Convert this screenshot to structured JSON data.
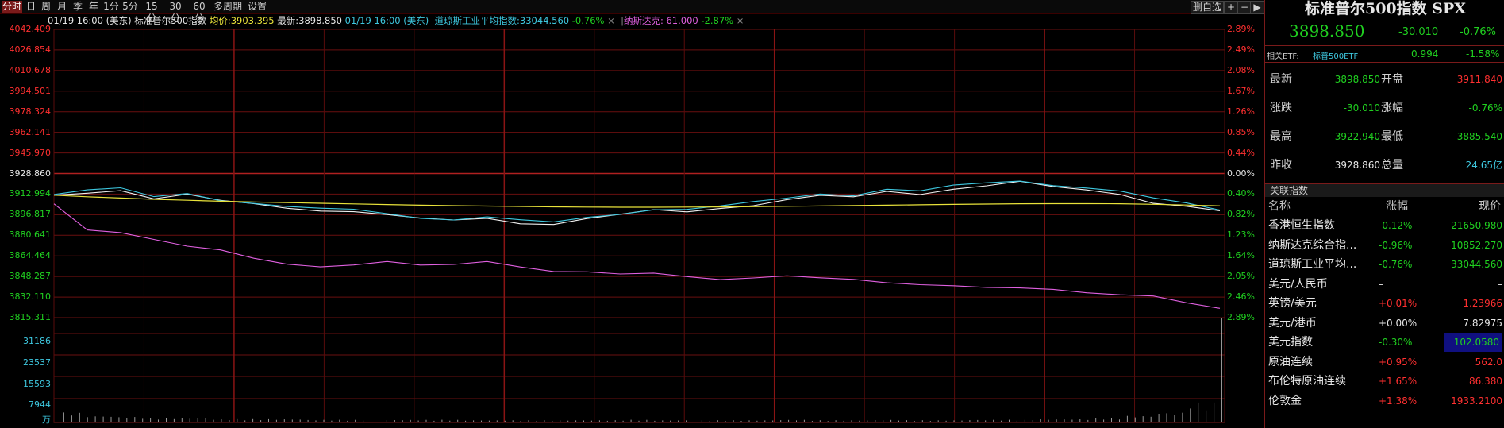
{
  "toolbar": {
    "periods": [
      {
        "label": "分时",
        "active": true
      },
      {
        "label": "日",
        "active": false
      },
      {
        "label": "周",
        "active": false
      },
      {
        "label": "月",
        "active": false
      },
      {
        "label": "季",
        "active": false
      },
      {
        "label": "年",
        "active": false
      },
      {
        "label": "1分",
        "active": false
      },
      {
        "label": "5分",
        "active": false
      },
      {
        "label": "15分",
        "active": false
      },
      {
        "label": "30分",
        "active": false
      },
      {
        "label": "60分",
        "active": false
      },
      {
        "label": "多周期",
        "active": false
      },
      {
        "label": "设置",
        "active": false
      }
    ],
    "remove_watch": "删自选",
    "add_icon": "+",
    "minus_icon": "−",
    "prev_icon": "◀",
    "next_icon": "▶"
  },
  "infoline": {
    "date": "01/19 16:00 (美东)",
    "name": "标准普尔500指数",
    "avg_label": "均价:",
    "avg_value": "3903.395",
    "last_label": "最新:",
    "last_value": "3898.850",
    "cmp_date": "01/19 16:00 (美东)",
    "dji_label": "道琼斯工业平均指数:",
    "dji_value": "33044.560",
    "dji_pct": "-0.76%",
    "close_icon": "×",
    "nas_label": "纳斯达克:",
    "nas_value": "61.000",
    "nas_pct": "-2.87%"
  },
  "chart_data": {
    "type": "line",
    "title": "标准普尔500指数 分时",
    "prev_close": 3928.86,
    "ylim": [
      3815.311,
      4042.409
    ],
    "price_ticks": [
      "4042.409",
      "4026.854",
      "4010.678",
      "3994.501",
      "3978.324",
      "3962.141",
      "3945.970",
      "3928.860",
      "3912.994",
      "3896.817",
      "3880.641",
      "3864.464",
      "3848.287",
      "3832.110",
      "3815.311"
    ],
    "pct_ticks": [
      "2.89%",
      "2.49%",
      "2.08%",
      "1.67%",
      "1.26%",
      "0.85%",
      "0.44%",
      "0.00%",
      "0.40%",
      "0.82%",
      "1.23%",
      "1.64%",
      "2.05%",
      "2.46%",
      "2.89%"
    ],
    "volume_ticks": [
      "31186",
      "23537",
      "15593",
      "7944",
      "万"
    ],
    "grid": true,
    "series": [
      {
        "name": "标准普尔500指数",
        "color": "#f0f0f0",
        "values": [
          3911.8,
          3914,
          3916,
          3909,
          3912,
          3907,
          3905,
          3902,
          3900,
          3899,
          3896,
          3893,
          3892,
          3894,
          3890,
          3889,
          3893,
          3896,
          3900,
          3899,
          3902,
          3904,
          3908,
          3911,
          3910,
          3915,
          3913,
          3917,
          3919,
          3922,
          3918,
          3916,
          3913,
          3906,
          3903,
          3898.85
        ]
      },
      {
        "name": "道琼斯工业平均指数",
        "color": "#3ec8e0",
        "values": [
          3913,
          3916,
          3917,
          3910,
          3913,
          3908,
          3906,
          3903,
          3901,
          3900,
          3897,
          3894,
          3893,
          3895,
          3892,
          3890,
          3894,
          3897,
          3901,
          3901,
          3903,
          3906,
          3909,
          3913,
          3912,
          3917,
          3915,
          3919,
          3921,
          3923,
          3920,
          3918,
          3915,
          3909,
          3905,
          3900
        ]
      },
      {
        "name": "均价",
        "color": "#e8e23a",
        "values": [
          3911.8,
          3910.5,
          3909.5,
          3908.5,
          3907.8,
          3907,
          3906.4,
          3905.9,
          3905.4,
          3904.9,
          3904.4,
          3903.9,
          3903.5,
          3903.2,
          3902.9,
          3902.6,
          3902.4,
          3902.3,
          3902.3,
          3902.4,
          3902.5,
          3902.7,
          3903,
          3903.3,
          3903.6,
          3903.9,
          3904.2,
          3904.5,
          3904.8,
          3905,
          3905.1,
          3905.1,
          3905,
          3904.6,
          3904,
          3903.4
        ]
      },
      {
        "name": "纳斯达克",
        "color": "#e060e0",
        "values": [
          3905,
          3885,
          3883,
          3877,
          3871,
          3868,
          3862,
          3858,
          3856,
          3857,
          3859,
          3856,
          3857,
          3860,
          3856,
          3852,
          3851,
          3849,
          3850,
          3848,
          3846,
          3847,
          3848,
          3846,
          3845,
          3843,
          3842,
          3841,
          3839,
          3838,
          3837,
          3835,
          3834,
          3833,
          3827,
          3822
        ]
      }
    ],
    "volume": [
      0.45,
      0.3,
      0.25,
      0.2,
      0.2,
      0.15,
      0.15,
      0.15,
      0.12,
      0.12,
      0.12,
      0.12,
      0.12,
      0.1,
      0.1,
      0.1,
      0.1,
      0.1,
      0.12,
      0.1,
      0.1,
      0.1,
      0.1,
      0.12,
      0.1,
      0.1,
      0.12,
      0.1,
      0.1,
      0.12,
      0.12,
      0.15,
      0.15,
      0.2,
      0.3,
      0.45,
      0.9
    ]
  },
  "panel": {
    "title": "标准普尔500指数 SPX",
    "price": "3898.850",
    "change": "-30.010",
    "change_pct": "-0.76%",
    "etf_label": "相关ETF:",
    "etf_name": "标普500ETF",
    "etf_price": "0.994",
    "etf_pct": "-1.58%",
    "quote": [
      {
        "l1": "最新",
        "v1": "3898.850",
        "l2": "开盘",
        "v2": "3911.840",
        "c1": "#20d020",
        "c2": "#ff3030"
      },
      {
        "l1": "涨跌",
        "v1": "-30.010",
        "l2": "涨幅",
        "v2": "-0.76%",
        "c1": "#20d020",
        "c2": "#20d020"
      },
      {
        "l1": "最高",
        "v1": "3922.940",
        "l2": "最低",
        "v2": "3885.540",
        "c1": "#20d020",
        "c2": "#20d020"
      },
      {
        "l1": "昨收",
        "v1": "3928.860",
        "l2": "总量",
        "v2": "24.65亿",
        "c1": "#e6e6e6",
        "c2": "#3ec8e0"
      }
    ],
    "related_header": "关联指数",
    "col_name": "名称",
    "col_pct": "涨幅",
    "col_price": "现价",
    "related": [
      {
        "name": "香港恒生指数",
        "pct": "-0.12%",
        "price": "21650.980",
        "color": "#20d020"
      },
      {
        "name": "纳斯达克综合指...",
        "pct": "-0.96%",
        "price": "10852.270",
        "color": "#20d020"
      },
      {
        "name": "道琼斯工业平均...",
        "pct": "-0.76%",
        "price": "33044.560",
        "color": "#20d020"
      },
      {
        "name": "美元/人民币",
        "pct": "–",
        "price": "–",
        "color": "#e6e6e6"
      },
      {
        "name": "英镑/美元",
        "pct": "+0.01%",
        "price": "1.23966",
        "color": "#ff3030"
      },
      {
        "name": "美元/港币",
        "pct": "+0.00%",
        "price": "7.82975",
        "color": "#e6e6e6"
      },
      {
        "name": "美元指数",
        "pct": "-0.30%",
        "price": "102.0580",
        "color": "#20d020",
        "highlight": true
      },
      {
        "name": "原油连续",
        "pct": "+0.95%",
        "price": "562.0",
        "color": "#ff3030"
      },
      {
        "name": "布伦特原油连续",
        "pct": "+1.65%",
        "price": "86.380",
        "color": "#ff3030"
      },
      {
        "name": "伦敦金",
        "pct": "+1.38%",
        "price": "1933.2100",
        "color": "#ff3030"
      }
    ]
  }
}
